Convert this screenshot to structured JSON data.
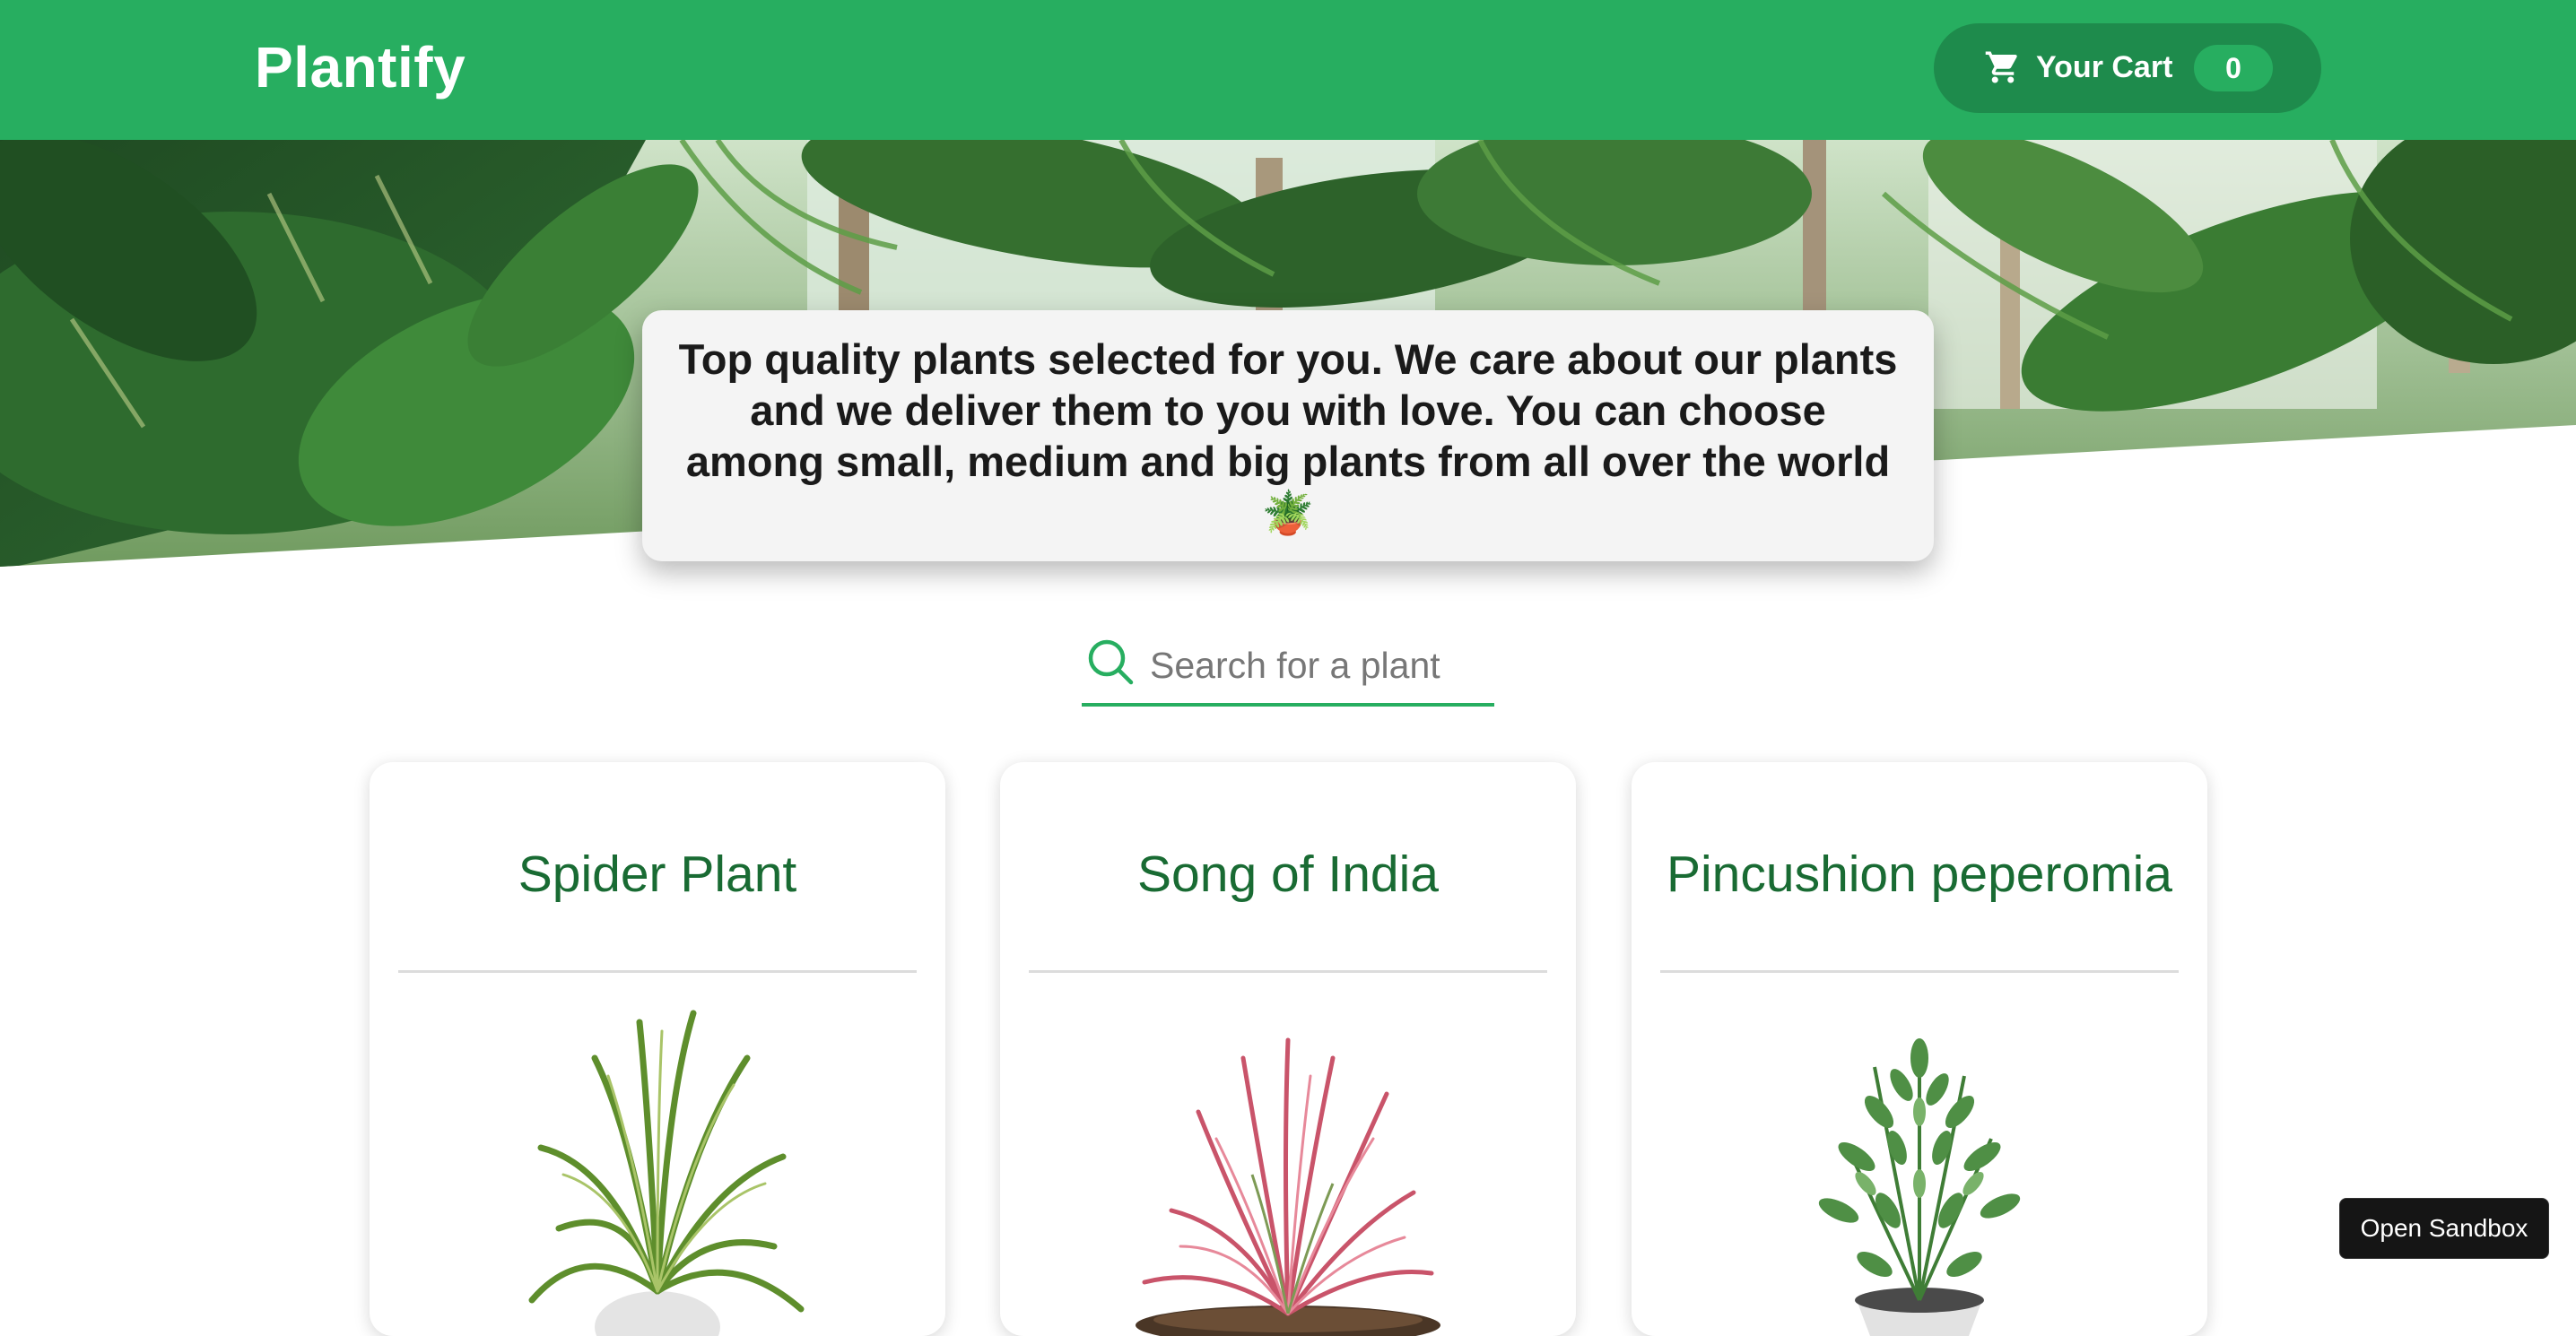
{
  "header": {
    "brand": "Plantify",
    "cart": {
      "label": "Your Cart",
      "count": "0",
      "icon": "cart-icon"
    }
  },
  "hero": {
    "intro": "Top quality plants selected for you. We care about our plants and we deliver them to you with love. You can choose among small, medium and big plants from all over the world 🪴"
  },
  "search": {
    "placeholder": "Search for a plant",
    "value": "",
    "icon": "search-icon"
  },
  "products": [
    {
      "name": "Spider Plant"
    },
    {
      "name": "Song of India"
    },
    {
      "name": "Pincushion peperomia"
    }
  ],
  "sandbox": {
    "label": "Open Sandbox"
  },
  "colors": {
    "brand_green": "#27ae60",
    "cart_pill": "#1e8b4c",
    "title_green": "#196b33",
    "intro_card": "#f4f4f4"
  }
}
